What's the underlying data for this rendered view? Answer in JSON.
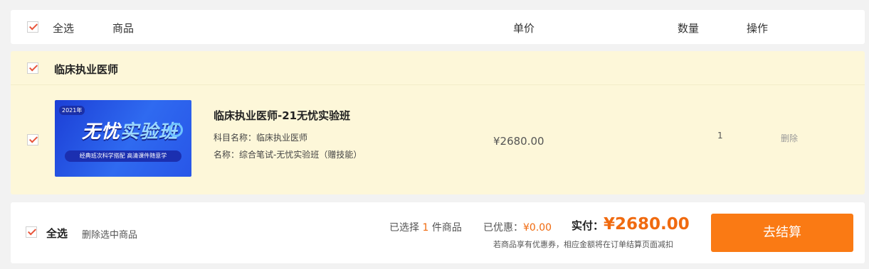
{
  "header": {
    "select_all": "全选",
    "col_product": "商品",
    "col_price": "单价",
    "col_qty": "数量",
    "col_action": "操作"
  },
  "group": {
    "title": "临床执业医师",
    "item": {
      "thumb_year": "2021年",
      "thumb_title_a": "无忧",
      "thumb_title_b": "实验班",
      "thumb_sub": "经典班次科学搭配 高清课件随意学",
      "name": "临床执业医师-21无忧实验班",
      "subject": "科目名称：临床执业医师",
      "desc": "名称：综合笔试-无忧实验班（赠技能）",
      "price": "¥2680.00",
      "qty": "1",
      "delete": "删除"
    }
  },
  "footer": {
    "select_all": "全选",
    "delete_selected": "删除选中商品",
    "selected_prefix": "已选择",
    "selected_count": "1",
    "selected_suffix": "件商品",
    "discount_label": "已优惠：",
    "discount_value": "¥0.00",
    "pay_label": "实付：",
    "pay_value": "¥2680.00",
    "note": "若商品享有优惠券，相应金额将在订单结算页面减扣",
    "checkout": "去结算"
  },
  "colors": {
    "accent": "#fa7a14",
    "price_orange": "#f06a0f",
    "group_bg": "#fdf7d9",
    "check": "#e8543a"
  }
}
